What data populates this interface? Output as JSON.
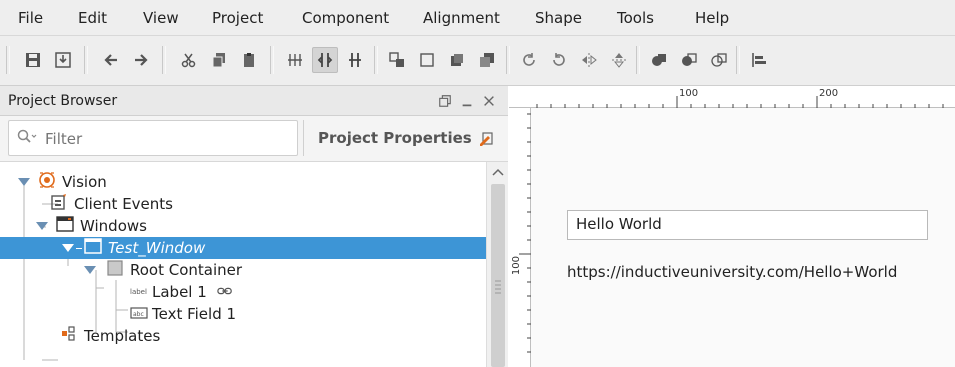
{
  "menubar": {
    "items": [
      "File",
      "Edit",
      "View",
      "Project",
      "Component",
      "Alignment",
      "Shape",
      "Tools",
      "Help"
    ]
  },
  "toolbar": {
    "buttons": [
      "save-icon",
      "import-icon",
      "undo-icon",
      "redo-icon",
      "cut-icon",
      "copy-icon",
      "paste-icon",
      "cleanup-icon",
      "layout-anchored-icon",
      "layout-relative-icon",
      "group-icon",
      "ungroup-icon",
      "bring-front-icon",
      "send-back-icon",
      "rotate-icon",
      "rotate-back-icon",
      "flip-horizontal-icon",
      "flip-vertical-icon",
      "union-icon",
      "difference-icon",
      "intersection-icon",
      "align-left-icon"
    ],
    "active_button": "layout-anchored-icon"
  },
  "project_browser": {
    "title": "Project Browser",
    "filter_placeholder": "Filter",
    "project_properties_label": "Project Properties",
    "tree": [
      {
        "label": "Vision",
        "level": 0,
        "expanded": true
      },
      {
        "label": "Client Events",
        "level": 1
      },
      {
        "label": "Windows",
        "level": 1,
        "expanded": true
      },
      {
        "label": "Test_Window",
        "level": 2,
        "expanded": true,
        "selected": true
      },
      {
        "label": "Root Container",
        "level": 3,
        "expanded": true
      },
      {
        "label": "Label 1",
        "level": 4
      },
      {
        "label": "Text Field 1",
        "level": 4
      },
      {
        "label": "Templates",
        "level": 1
      }
    ]
  },
  "designer": {
    "ruler_top_labels": [
      "100",
      "200"
    ],
    "ruler_left_labels": [
      "100"
    ],
    "text_field_value": "Hello World",
    "label_text": "https://inductiveuniversity.com/Hello+World"
  },
  "colors": {
    "selection": "#3d95d6",
    "menubar_bg": "#eeeeee",
    "vision_accent": "#e06a1b"
  }
}
